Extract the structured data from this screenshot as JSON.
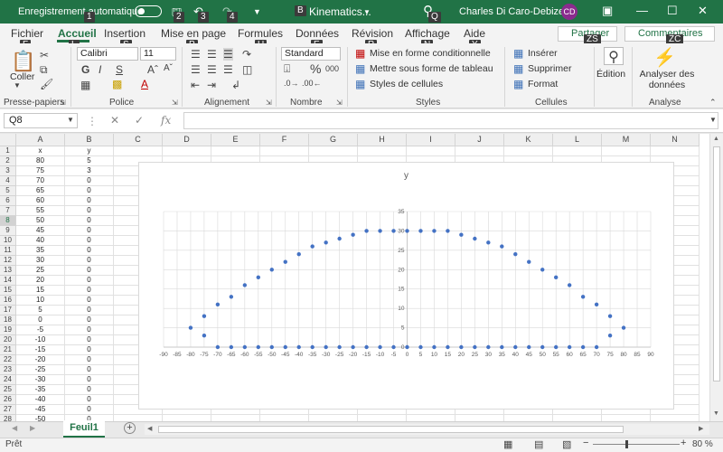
{
  "titlebar": {
    "autosave_label": "Enregistrement automatique",
    "doc_name": "Kinematics...",
    "doc_badge": "B",
    "user_name": "Charles Di Caro-Debizet",
    "user_initials": "CD",
    "keytips": [
      "1",
      "2",
      "3",
      "4",
      "Q"
    ]
  },
  "tabs": {
    "items": [
      "Fichier",
      "Accueil",
      "Insertion",
      "Mise en page",
      "Formules",
      "Données",
      "Révision",
      "Affichage",
      "Aide"
    ],
    "keytips": [
      "F",
      "L",
      "S",
      "P",
      "U",
      "E",
      "R",
      "N",
      "Y"
    ],
    "share_label": "Partager",
    "share_keytip": "ZS",
    "comments_label": "Commentaires",
    "comments_keytip": "ZC"
  },
  "ribbon": {
    "paste_label": "Coller",
    "font_name": "Calibri",
    "font_size": "11",
    "number_format": "Standard",
    "conditional_format": "Mise en forme conditionnelle",
    "format_table": "Mettre sous forme de tableau",
    "cell_styles": "Styles de cellules",
    "insert": "Insérer",
    "delete": "Supprimer",
    "format": "Format",
    "edit": "Édition",
    "analyze": "Analyser des données",
    "groups": [
      "Presse-papiers",
      "Police",
      "Alignement",
      "Nombre",
      "Styles",
      "Cellules",
      "Analyse"
    ],
    "bold": "G",
    "italic": "I",
    "underline": "S"
  },
  "formula_bar": {
    "name_box": "Q8",
    "formula": ""
  },
  "grid": {
    "columns": [
      "A",
      "B",
      "C",
      "D",
      "E",
      "F",
      "G",
      "H",
      "I",
      "J",
      "K",
      "L",
      "M",
      "N"
    ],
    "row_numbers": [
      "1",
      "2",
      "3",
      "4",
      "5",
      "6",
      "7",
      "8",
      "9",
      "10",
      "11",
      "12",
      "13",
      "14",
      "15",
      "16",
      "17",
      "18",
      "19",
      "20",
      "21",
      "22",
      "23",
      "24",
      "25",
      "26",
      "27",
      "28"
    ],
    "selected_row": "8",
    "col_a": [
      "x",
      "80",
      "75",
      "70",
      "65",
      "60",
      "55",
      "50",
      "45",
      "40",
      "35",
      "30",
      "25",
      "20",
      "15",
      "10",
      "5",
      "0",
      "-5",
      "-10",
      "-15",
      "-20",
      "-25",
      "-30",
      "-35",
      "-40",
      "-45",
      "-50"
    ],
    "col_b": [
      "y",
      "5",
      "3",
      "0",
      "0",
      "0",
      "0",
      "0",
      "0",
      "0",
      "0",
      "0",
      "0",
      "0",
      "0",
      "0",
      "0",
      "0",
      "0",
      "0",
      "0",
      "0",
      "0",
      "0",
      "0",
      "0",
      "0",
      "0"
    ]
  },
  "chart_data": {
    "type": "scatter",
    "title": "y",
    "xlim": [
      -90,
      90
    ],
    "ylim": [
      0,
      35
    ],
    "x_ticks": [
      -90,
      -85,
      -80,
      -75,
      -70,
      -65,
      -60,
      -55,
      -50,
      -45,
      -40,
      -35,
      -30,
      -25,
      -20,
      -15,
      -10,
      -5,
      0,
      5,
      10,
      15,
      20,
      25,
      30,
      35,
      40,
      45,
      50,
      55,
      60,
      65,
      70,
      75,
      80,
      85,
      90
    ],
    "y_ticks": [
      0,
      5,
      10,
      15,
      20,
      25,
      30,
      35
    ],
    "grid": true,
    "color": "#4472c4",
    "points": [
      [
        -80,
        5
      ],
      [
        -75,
        3
      ],
      [
        -75,
        8
      ],
      [
        -70,
        11
      ],
      [
        -65,
        13
      ],
      [
        -60,
        16
      ],
      [
        -55,
        18
      ],
      [
        -50,
        20
      ],
      [
        -45,
        22
      ],
      [
        -40,
        24
      ],
      [
        -35,
        26
      ],
      [
        -30,
        27
      ],
      [
        -25,
        28
      ],
      [
        -20,
        29
      ],
      [
        -15,
        30
      ],
      [
        -10,
        30
      ],
      [
        -5,
        30
      ],
      [
        0,
        30
      ],
      [
        5,
        30
      ],
      [
        10,
        30
      ],
      [
        15,
        30
      ],
      [
        20,
        29
      ],
      [
        25,
        28
      ],
      [
        30,
        27
      ],
      [
        35,
        26
      ],
      [
        40,
        24
      ],
      [
        45,
        22
      ],
      [
        50,
        20
      ],
      [
        55,
        18
      ],
      [
        60,
        16
      ],
      [
        65,
        13
      ],
      [
        70,
        11
      ],
      [
        75,
        8
      ],
      [
        75,
        3
      ],
      [
        80,
        5
      ],
      [
        -70,
        0
      ],
      [
        -65,
        0
      ],
      [
        -60,
        0
      ],
      [
        -55,
        0
      ],
      [
        -50,
        0
      ],
      [
        -45,
        0
      ],
      [
        -40,
        0
      ],
      [
        -35,
        0
      ],
      [
        -30,
        0
      ],
      [
        -25,
        0
      ],
      [
        -20,
        0
      ],
      [
        -15,
        0
      ],
      [
        -10,
        0
      ],
      [
        -5,
        0
      ],
      [
        0,
        0
      ],
      [
        5,
        0
      ],
      [
        10,
        0
      ],
      [
        15,
        0
      ],
      [
        20,
        0
      ],
      [
        25,
        0
      ],
      [
        30,
        0
      ],
      [
        35,
        0
      ],
      [
        40,
        0
      ],
      [
        45,
        0
      ],
      [
        50,
        0
      ],
      [
        55,
        0
      ],
      [
        60,
        0
      ],
      [
        65,
        0
      ],
      [
        70,
        0
      ]
    ]
  },
  "sheets": {
    "active": "Feuil1",
    "add_icon": "+"
  },
  "status": {
    "ready": "Prêt",
    "zoom": "80 %"
  },
  "colors": {
    "accent": "#217346",
    "series": "#4472c4"
  }
}
